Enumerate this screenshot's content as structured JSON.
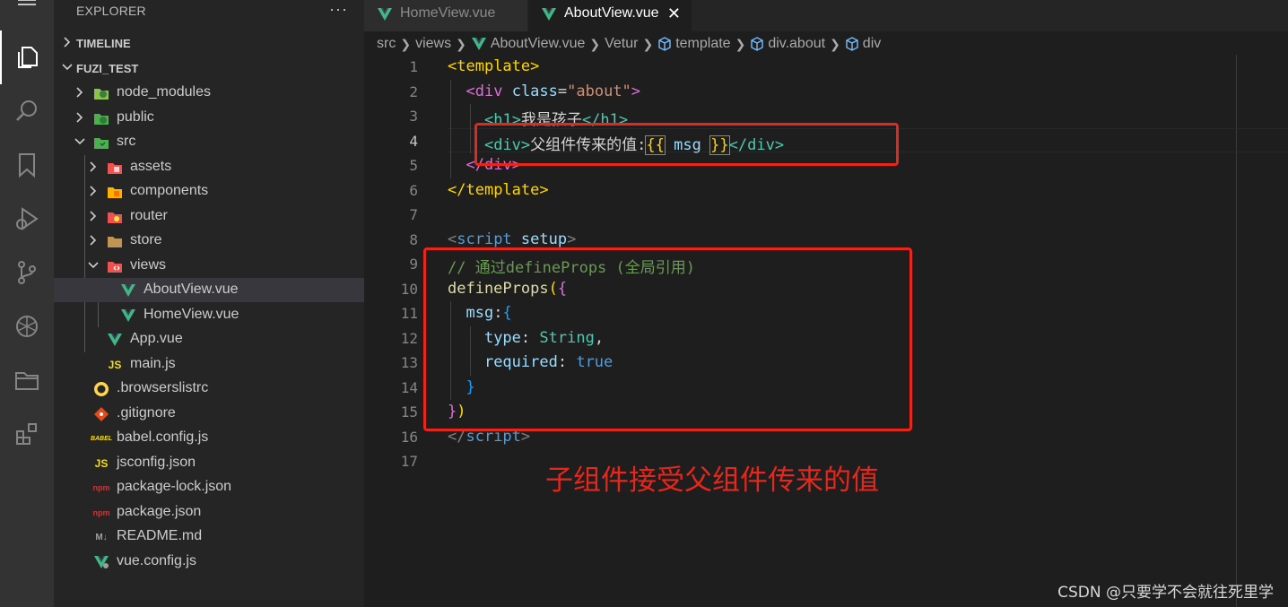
{
  "sidebar": {
    "header": "EXPLORER",
    "more": "···",
    "sections": {
      "timeline": "TIMELINE",
      "project": "FUZI_TEST"
    },
    "tree": [
      {
        "label": "node_modules"
      },
      {
        "label": "public"
      },
      {
        "label": "src"
      },
      {
        "label": "assets"
      },
      {
        "label": "components"
      },
      {
        "label": "router"
      },
      {
        "label": "store"
      },
      {
        "label": "views"
      },
      {
        "label": "AboutView.vue"
      },
      {
        "label": "HomeView.vue"
      },
      {
        "label": "App.vue"
      },
      {
        "label": "main.js"
      },
      {
        "label": ".browserslistrc"
      },
      {
        "label": ".gitignore"
      },
      {
        "label": "babel.config.js"
      },
      {
        "label": "jsconfig.json"
      },
      {
        "label": "package-lock.json"
      },
      {
        "label": "package.json"
      },
      {
        "label": "README.md"
      },
      {
        "label": "vue.config.js"
      }
    ],
    "icon_text": {
      "js": "JS",
      "md": "M↓",
      "babel": "BABEL",
      "npm": "npm"
    }
  },
  "tabs": [
    {
      "label": "HomeView.vue"
    },
    {
      "label": "AboutView.vue",
      "close": "✕"
    }
  ],
  "breadcrumb": [
    "src",
    "views",
    "AboutView.vue",
    "Vetur",
    "template",
    "div.about",
    "div"
  ],
  "editor": {
    "line_numbers": [
      "1",
      "2",
      "3",
      "4",
      "5",
      "6",
      "7",
      "8",
      "9",
      "10",
      "11",
      "12",
      "13",
      "14",
      "15",
      "16",
      "17"
    ],
    "current_line": "4"
  },
  "code": {
    "l1": {
      "open": "<",
      "tag": "template",
      "close": ">"
    },
    "l2": {
      "open": "<",
      "tag": "div",
      "attr": "class",
      "eq": "=",
      "val": "\"about\"",
      "close": ">"
    },
    "l3": {
      "open": "<",
      "tag": "h1",
      "close": ">",
      "text": "我是孩子",
      "end_open": "</",
      "end_tag": "h1",
      "end_close": ">"
    },
    "l4": {
      "open": "<",
      "tag": "div",
      "close": ">",
      "text": "父组件传来的值:",
      "mus_open": "{{",
      "var": "msg",
      "mus_close": "}}",
      "end_open": "</",
      "end_tag": "div",
      "end_close": ">"
    },
    "l5": {
      "open": "</",
      "tag": "div",
      "close": ">"
    },
    "l6": {
      "open": "</",
      "tag": "template",
      "close": ">"
    },
    "l8": {
      "open": "<",
      "tag": "script",
      "attr": "setup",
      "close": ">"
    },
    "l9": {
      "comment": "// 通过defineProps (全局引用)"
    },
    "l10": {
      "fn": "defineProps",
      "paren": "(",
      "brace": "{"
    },
    "l11": {
      "key": "msg",
      "colon": ":",
      "brace": "{"
    },
    "l12": {
      "key": "type",
      "colon": ": ",
      "value": "String",
      "comma": ","
    },
    "l13": {
      "key": "required",
      "colon": ": ",
      "value": "true"
    },
    "l14": {
      "brace": "}"
    },
    "l15": {
      "brace": "}",
      "paren": ")"
    },
    "l16": {
      "open": "</",
      "tag": "script",
      "close": ">"
    }
  },
  "annotation": "子组件接受父组件传来的值",
  "watermark": "CSDN @只要学不会就往死里学",
  "colors": {
    "highlight_box": "#e8261b",
    "vue_green": "#41b883",
    "editor_bg": "#1e1e1e",
    "sidebar_bg": "#252526"
  }
}
